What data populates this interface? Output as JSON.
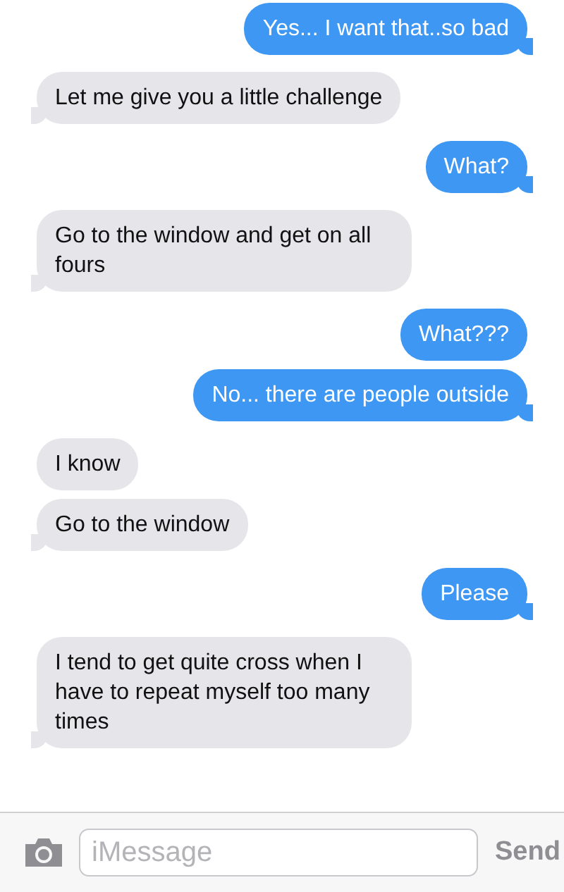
{
  "messages": [
    {
      "kind": "sent",
      "text": "Yes... I want that..so bad"
    },
    {
      "kind": "received",
      "text": "Let me give you a little challenge"
    },
    {
      "kind": "sent",
      "text": "What?"
    },
    {
      "kind": "received",
      "text": "Go to the window and get on all fours"
    },
    {
      "kind": "sent",
      "text": "What???"
    },
    {
      "kind": "sent",
      "text": "No... there are people outside"
    },
    {
      "kind": "received",
      "text": "I know"
    },
    {
      "kind": "received",
      "text": "Go to the window"
    },
    {
      "kind": "sent",
      "text": "Please"
    },
    {
      "kind": "received",
      "text": "I tend to get quite cross when I have to repeat myself too many times"
    }
  ],
  "composer": {
    "placeholder": "iMessage",
    "send": "Send"
  }
}
